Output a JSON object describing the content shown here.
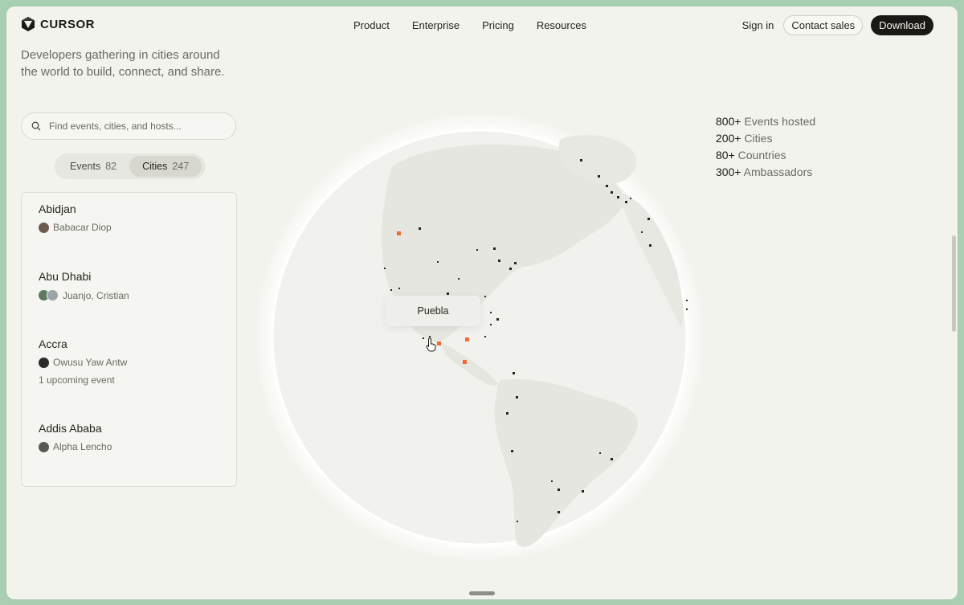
{
  "header": {
    "brand": "CURSOR",
    "nav": [
      "Product",
      "Enterprise",
      "Pricing",
      "Resources"
    ],
    "sign_in": "Sign in",
    "contact_sales": "Contact sales",
    "download": "Download"
  },
  "tagline": "Developers gathering in cities around the world to build, connect, and share.",
  "search": {
    "placeholder": "Find events, cities, and hosts..."
  },
  "toggle": {
    "events_label": "Events",
    "events_count": "82",
    "cities_label": "Cities",
    "cities_count": "247"
  },
  "cities": [
    {
      "name": "Abidjan",
      "hosts": "Babacar Diop",
      "extra": ""
    },
    {
      "name": "Abu Dhabi",
      "hosts": "Juanjo, Cristian",
      "extra": ""
    },
    {
      "name": "Accra",
      "hosts": "Owusu Yaw Antw",
      "extra": "1 upcoming event"
    },
    {
      "name": "Addis Ababa",
      "hosts": "Alpha Lencho",
      "extra": ""
    }
  ],
  "stats": [
    {
      "num": "800+",
      "label": "Events hosted"
    },
    {
      "num": "200+",
      "label": "Cities"
    },
    {
      "num": "80+",
      "label": "Countries"
    },
    {
      "num": "300+",
      "label": "Ambassadors"
    }
  ],
  "map": {
    "tooltip": "Puebla",
    "accent": "#f06a36"
  },
  "icons": {
    "logo": "cursor-logo-icon",
    "search": "search-icon",
    "pointer": "hand-pointer-icon"
  }
}
